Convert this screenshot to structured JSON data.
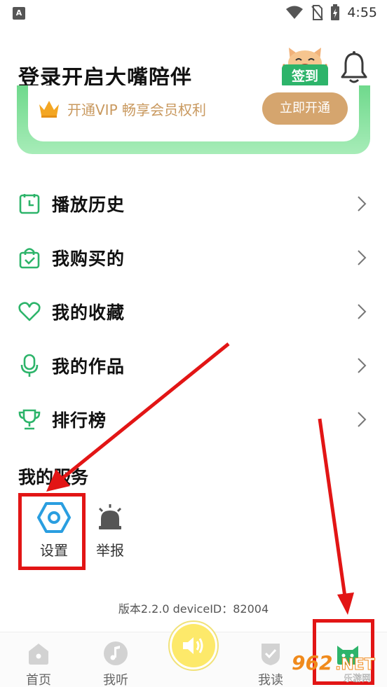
{
  "status_bar": {
    "notification_icon_text": "A",
    "time": "4:55"
  },
  "header": {
    "login_title": "登录开启大嘴陪伴",
    "signin_label": "签到"
  },
  "vip": {
    "text": "开通VIP 畅享会员权利",
    "button_label": "立即开通"
  },
  "menu": [
    {
      "label": "播放历史",
      "icon": "clock-icon"
    },
    {
      "label": "我购买的",
      "icon": "shopping-bag-icon"
    },
    {
      "label": "我的收藏",
      "icon": "heart-icon"
    },
    {
      "label": "我的作品",
      "icon": "microphone-icon"
    },
    {
      "label": "排行榜",
      "icon": "trophy-icon"
    }
  ],
  "services": {
    "title": "我的服务",
    "items": [
      {
        "label": "设置",
        "icon": "settings-hexagon-icon"
      },
      {
        "label": "举报",
        "icon": "alarm-siren-icon"
      }
    ]
  },
  "footer": {
    "version_text": "版本2.2.0  deviceID：82004"
  },
  "bottom_nav": {
    "items": [
      {
        "label": "首页",
        "icon": "home-icon"
      },
      {
        "label": "我听",
        "icon": "music-note-icon"
      },
      {
        "label": "",
        "icon": "speaker-icon"
      },
      {
        "label": "我读",
        "icon": "reading-shield-icon"
      },
      {
        "label": "",
        "icon": "cat-profile-icon"
      }
    ]
  },
  "watermark": {
    "text": "962.NET",
    "subtext": "乐游网"
  },
  "colors": {
    "brand_green": "#2db46a",
    "vip_gold": "#d5a56e",
    "annotation_red": "#e21515",
    "center_yellow": "#fde96a"
  }
}
